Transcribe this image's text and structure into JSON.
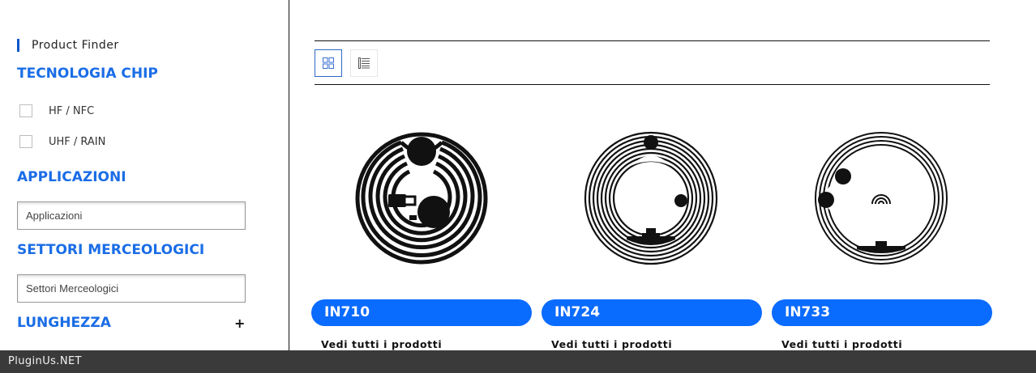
{
  "sidebar": {
    "finder_label": "Product Finder",
    "tecnologia": {
      "title": "TECNOLOGIA CHIP",
      "options": [
        {
          "label": "HF / NFC",
          "checked": false
        },
        {
          "label": "UHF / RAIN",
          "checked": false
        }
      ]
    },
    "applicazioni": {
      "title": "APPLICAZIONI",
      "selected": "Applicazioni"
    },
    "settori": {
      "title": "SETTORI MERCEOLOGICI",
      "selected": "Settori Merceologici"
    },
    "lunghezza": {
      "title": "LUNGHEZZA",
      "toggle": "+"
    }
  },
  "toolbar": {
    "views": [
      {
        "icon": "grid-view-icon",
        "active": true
      },
      {
        "icon": "list-view-icon",
        "active": false
      }
    ]
  },
  "products": [
    {
      "name": "IN710",
      "link": "Vedi tutti i prodotti",
      "image": "rfid-inlay-icon"
    },
    {
      "name": "IN724",
      "link": "Vedi tutti i prodotti",
      "image": "rfid-inlay-icon"
    },
    {
      "name": "IN733",
      "link": "Vedi tutti i prodotti",
      "image": "rfid-inlay-icon"
    }
  ],
  "footer": {
    "text": "PluginUs.NET"
  },
  "colors": {
    "accent": "#1a6de6",
    "pill": "#0a6bff",
    "footer": "#3a3a3a"
  }
}
